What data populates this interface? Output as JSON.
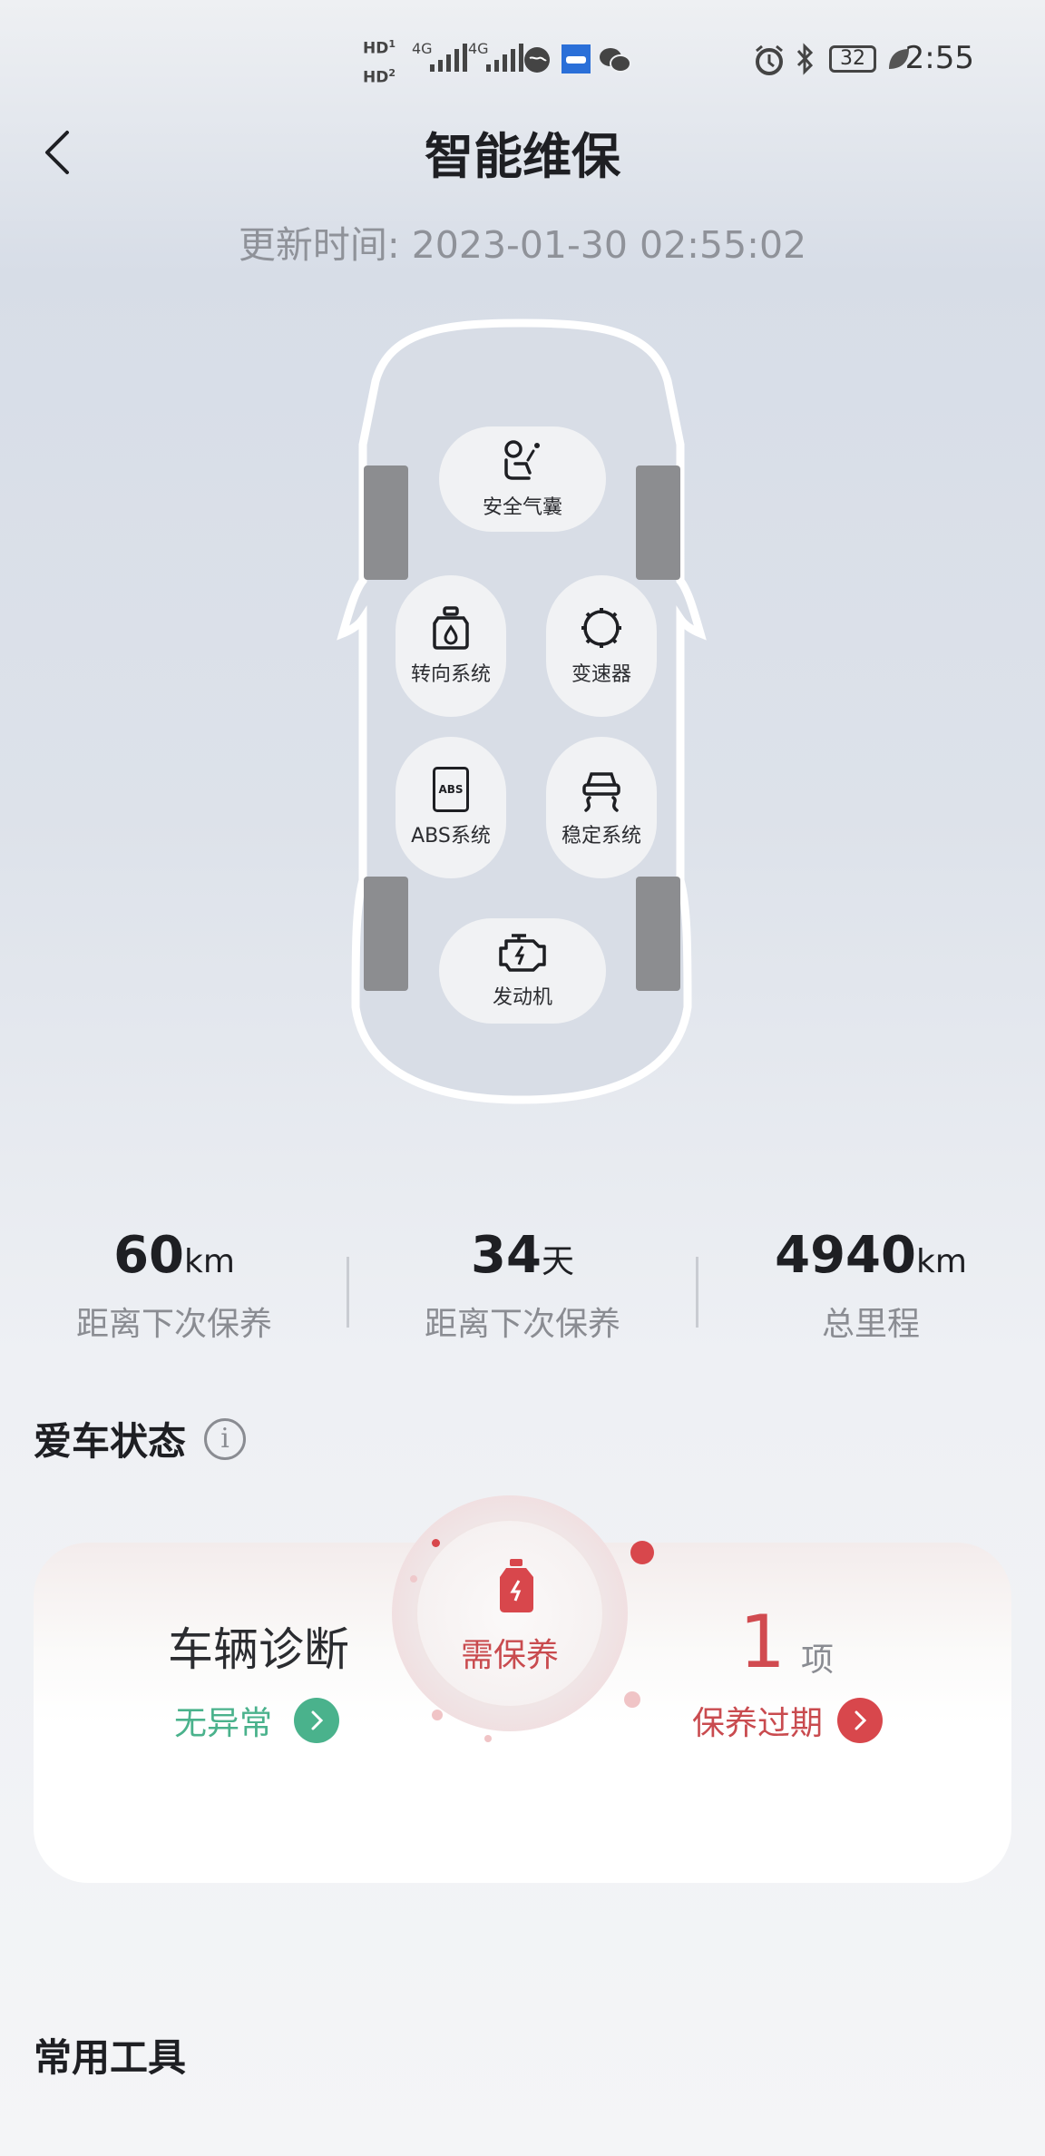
{
  "status_bar": {
    "hd1": "HD",
    "hd1_sub": "1",
    "hd2": "HD",
    "hd2_sub": "2",
    "net1": "4G",
    "net2": "4G",
    "battery": "32",
    "time": "2:55"
  },
  "header": {
    "title": "智能维保",
    "update_time": "更新时间: 2023-01-30 02:55:02"
  },
  "car_systems": {
    "airbag": "安全气囊",
    "steering": "转向系统",
    "transmission": "变速器",
    "abs": "ABS系统",
    "abs_icon_text": "ABS",
    "stability": "稳定系统",
    "engine": "发动机"
  },
  "stats": [
    {
      "value": "60",
      "unit": "km",
      "label": "距离下次保养"
    },
    {
      "value": "34",
      "unit": "天",
      "label": "距离下次保养"
    },
    {
      "value": "4940",
      "unit": "km",
      "label": "总里程"
    }
  ],
  "car_status": {
    "title": "爱车状态",
    "info_icon_text": "i",
    "diagnosis_title": "车辆诊断",
    "diagnosis_status": "无异常",
    "center_label": "需保养",
    "count": "1",
    "count_unit": "项",
    "overdue_label": "保养过期"
  },
  "tools": {
    "title": "常用工具"
  },
  "colors": {
    "accent_green": "#4ab28c",
    "accent_red": "#c94b4f"
  }
}
